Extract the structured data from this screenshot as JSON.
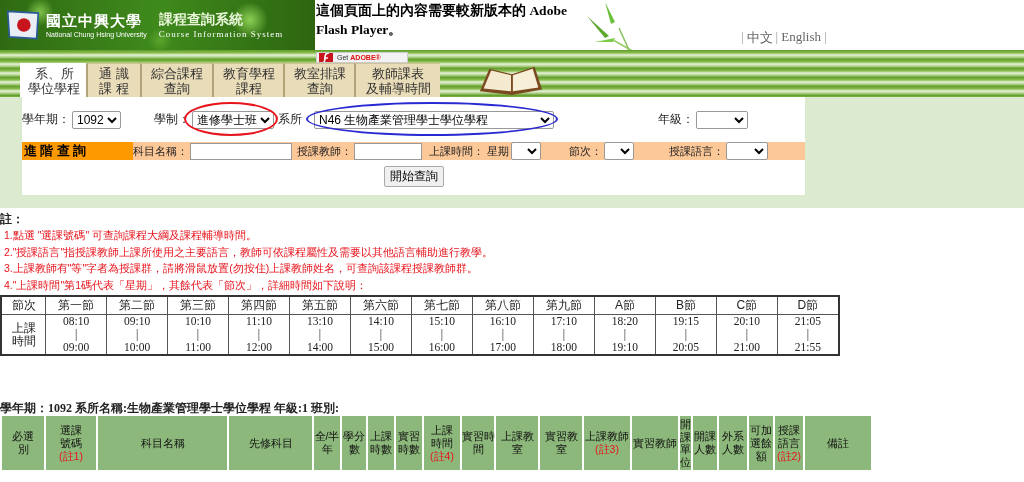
{
  "header": {
    "school_name": "國立中興大學",
    "school_name_en": "National Chung Hsing University",
    "system_title": "課程查詢系統",
    "system_title_en": "Course Information System"
  },
  "flash_notice": {
    "text": "這個頁面上的內容需要較新版本的 Adobe Flash Player。",
    "badge_get": "Get",
    "badge_brand": "ADOBE®"
  },
  "language_links": [
    {
      "kind": "separator",
      "text": "|"
    },
    {
      "kind": "link",
      "text": "中文"
    },
    {
      "kind": "separator",
      "text": "|"
    },
    {
      "kind": "link",
      "text": "English"
    },
    {
      "kind": "separator",
      "text": "|"
    }
  ],
  "tabs": [
    {
      "lines": [
        "系、所",
        "學位學程"
      ],
      "selected": true
    },
    {
      "lines": [
        "通 識",
        "課 程"
      ],
      "selected": false
    },
    {
      "lines": [
        "綜合課程",
        "查詢"
      ],
      "selected": false
    },
    {
      "lines": [
        "教育學程",
        "課程"
      ],
      "selected": false
    },
    {
      "lines": [
        "教室排課",
        "查詢"
      ],
      "selected": false
    },
    {
      "lines": [
        "教師課表",
        "及輔導時間"
      ],
      "selected": false
    }
  ],
  "basic_search": [
    {
      "label": "學年期：",
      "value": "1092"
    },
    {
      "label": "學制：",
      "value": "進修學士班",
      "color": "#e8141c"
    },
    {
      "label": "系所",
      "value": "N46 生物產業管理學士學位學程",
      "color": "#2a2ad2"
    },
    {
      "label": "年級："
    }
  ],
  "advanced_search": {
    "title": "進 階 查 詢",
    "fields": [
      {
        "kind": "text",
        "label": "科目名稱："
      },
      {
        "kind": "text",
        "label": "授課教師："
      },
      {
        "kind": "select",
        "label": "上課時間： 星期"
      },
      {
        "kind": "select",
        "label": "節次："
      },
      {
        "kind": "select",
        "label": "授課語言："
      }
    ]
  },
  "search_button": "開始查詢",
  "notes": {
    "title": "註：",
    "items": [
      "1.點選 \"選課號碼\" 可查詢課程大綱及課程輔導時間。",
      "2.\"授課語言\"指授課教師上課所使用之主要語言，教師可依課程屬性及需要以其他語言輔助進行教學。",
      "3.上課教師有\"等\"字者為授課群，請將滑鼠放置(勿按住)上課教師姓名，可查詢該課程授課教師群。",
      "4.\"上課時間\"第1碼代表「星期」，其餘代表「節次」，詳細時間如下說明："
    ]
  },
  "period_table": {
    "header_label": "節次",
    "row_label": [
      "上課",
      "時間"
    ],
    "periods": [
      {
        "name": "第一節",
        "start": "08:10",
        "mark": "|",
        "end": "09:00"
      },
      {
        "name": "第二節",
        "start": "09:10",
        "mark": "|",
        "end": "10:00"
      },
      {
        "name": "第三節",
        "start": "10:10",
        "mark": "|",
        "end": "11:00"
      },
      {
        "name": "第四節",
        "start": "11:10",
        "mark": "|",
        "end": "12:00"
      },
      {
        "name": "第五節",
        "start": "13:10",
        "mark": "|",
        "end": "14:00"
      },
      {
        "name": "第六節",
        "start": "14:10",
        "mark": "|",
        "end": "15:00"
      },
      {
        "name": "第七節",
        "start": "15:10",
        "mark": "|",
        "end": "16:00"
      },
      {
        "name": "第八節",
        "start": "16:10",
        "mark": "|",
        "end": "17:00"
      },
      {
        "name": "第九節",
        "start": "17:10",
        "mark": "|",
        "end": "18:00"
      },
      {
        "name": "A節",
        "start": "18:20",
        "mark": "|",
        "end": "19:10"
      },
      {
        "name": "B節",
        "start": "19:15",
        "mark": "|",
        "end": "20:05"
      },
      {
        "name": "C節",
        "start": "20:10",
        "mark": "|",
        "end": "21:00"
      },
      {
        "name": "D節",
        "start": "21:05",
        "mark": "|",
        "end": "21:55"
      }
    ]
  },
  "result": {
    "heading": "學年期：1092 系所名稱:生物產業管理學士學位學程 年級:1 班別:",
    "columns": [
      {
        "lines": [
          "必選",
          "別"
        ]
      },
      {
        "lines": [
          "選課",
          "號碼"
        ],
        "note": "(註1)"
      },
      {
        "lines": [
          "科目名稱"
        ]
      },
      {
        "lines": [
          "先修科目"
        ]
      },
      {
        "lines": [
          "全/半",
          "年"
        ]
      },
      {
        "lines": [
          "學分",
          "數"
        ]
      },
      {
        "lines": [
          "上課",
          "時數"
        ]
      },
      {
        "lines": [
          "實習",
          "時數"
        ]
      },
      {
        "lines": [
          "上課",
          "時間"
        ],
        "note": "(註4)"
      },
      {
        "lines": [
          "實習時",
          "間"
        ]
      },
      {
        "lines": [
          "上課教",
          "室"
        ]
      },
      {
        "lines": [
          "實習教",
          "室"
        ]
      },
      {
        "lines": [
          "上課教師"
        ],
        "note": "(註3)"
      },
      {
        "lines": [
          "實習教師"
        ]
      },
      {
        "lines": [
          "開",
          "課",
          "單",
          "位"
        ]
      },
      {
        "lines": [
          "開課",
          "人數"
        ]
      },
      {
        "lines": [
          "外系",
          "人數"
        ]
      },
      {
        "lines": [
          "可加",
          "選餘",
          "額"
        ]
      },
      {
        "lines": [
          "授課",
          "語言"
        ],
        "note": "(註2)"
      },
      {
        "lines": [
          "備註"
        ]
      }
    ]
  }
}
